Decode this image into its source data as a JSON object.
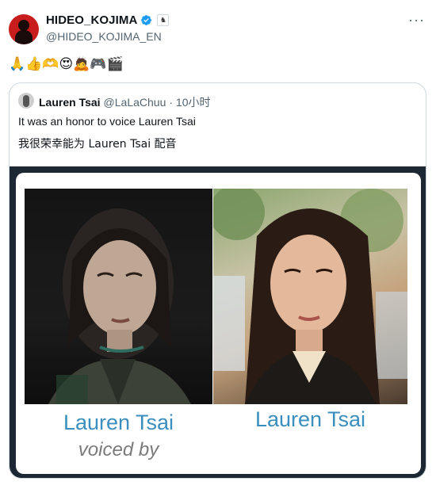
{
  "tweet": {
    "display_name": "HIDEO_KOJIMA",
    "handle": "@HIDEO_KOJIMA_EN",
    "more_label": "···",
    "emojis": "🙏👍🫶😍🙇🎮🎬"
  },
  "quote": {
    "name": "Lauren Tsai",
    "handle": "@LaLaChuu",
    "time": "· 10小时",
    "text_en": "It was an honor to voice Lauren Tsai",
    "text_zh": "我很荣幸能为 Lauren Tsai 配音",
    "media": {
      "left_label": "Lauren Tsai",
      "right_label": "Lauren Tsai",
      "voiced_by": "voiced by"
    }
  },
  "colors": {
    "verified": "#1d9bf0",
    "avatar_bg": "#c81d1d",
    "label_blue": "#3a8fbe",
    "muted": "#536471"
  }
}
